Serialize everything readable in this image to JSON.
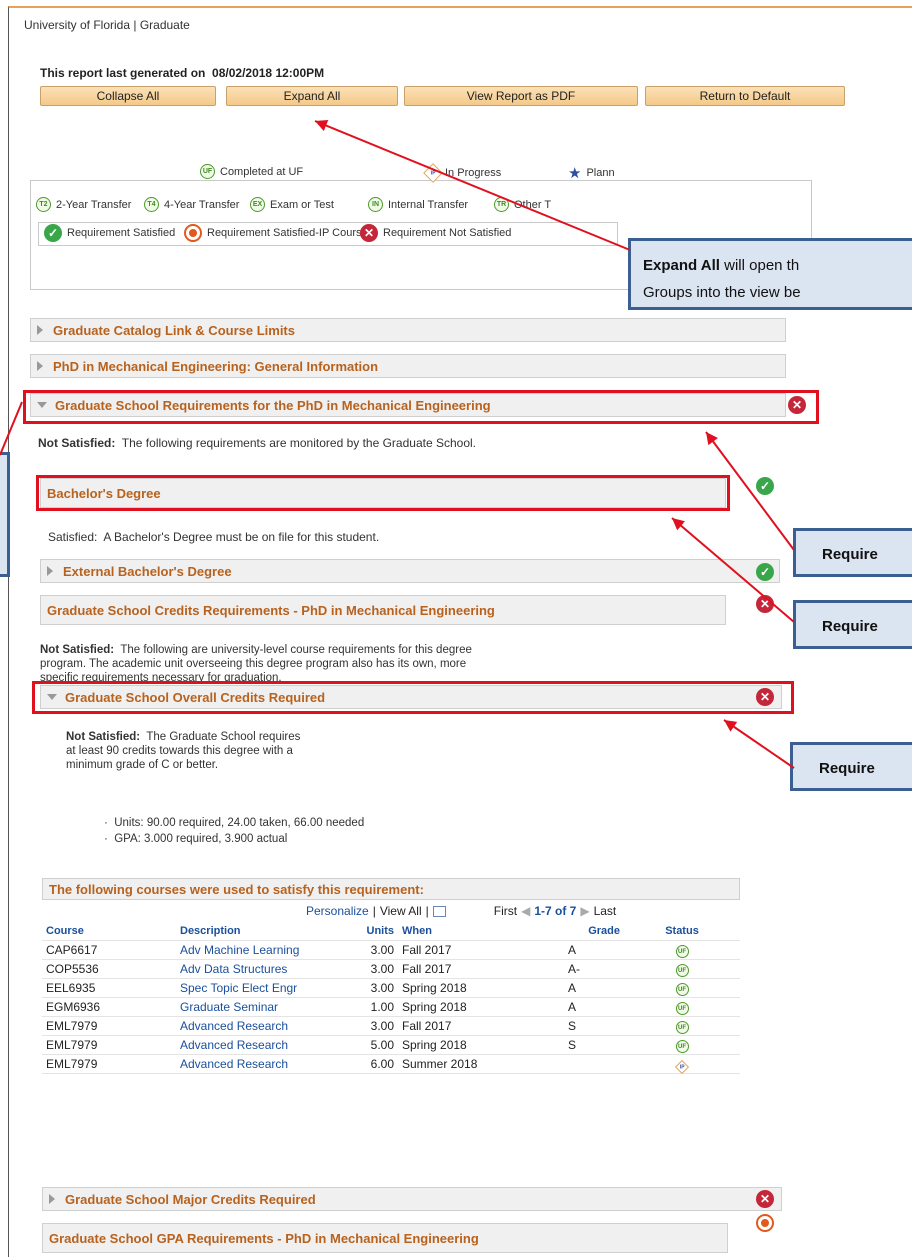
{
  "header": {
    "org": "University of Florida | Graduate",
    "generated_label": "This report last generated on",
    "generated_date": "08/02/2018 12:00PM"
  },
  "buttons": {
    "collapse": "Collapse All",
    "expand": "Expand All",
    "pdf": "View Report as PDF",
    "default": "Return to Default"
  },
  "legend": {
    "completed": "Completed at UF",
    "in_progress": "In Progress",
    "planned": "Plann",
    "t2": "2-Year Transfer",
    "t4": "4-Year Transfer",
    "exam": "Exam or Test",
    "internal": "Internal Transfer",
    "other": "Other T",
    "satisfied": "Requirement Satisfied",
    "satisfied_ip": "Requirement Satisfied-IP Course",
    "not_satisfied": "Requirement Not Satisfied",
    "icons": {
      "uf": "UF",
      "ip": "IP",
      "t2": "T2",
      "t4": "T4",
      "ex": "EX",
      "in": "IN",
      "tr": "TR"
    }
  },
  "sections": {
    "catalog": "Graduate Catalog Link & Course Limits",
    "general": "PhD in Mechanical Engineering: General Information",
    "grad_req": "Graduate School Requirements for the PhD in Mechanical Engineering",
    "grad_req_status_label": "Not Satisfied:",
    "grad_req_status_text": "The following requirements are monitored by the Graduate School.",
    "bachelors": "Bachelor's Degree",
    "bachelors_status_label": "Satisfied:",
    "bachelors_status_text": "A Bachelor's Degree must be on file for this student.",
    "external": "External Bachelor's Degree",
    "credits": "Graduate School Credits Requirements - PhD in Mechanical Engineering",
    "credits_status_label": "Not Satisfied:",
    "credits_status_line1": "The following are university-level course requirements for this degree",
    "credits_status_line2": "program. The academic unit overseeing this degree program also has its own, more",
    "credits_status_line3": "specific requirements necessary for graduation.",
    "overall": "Graduate School Overall Credits Required",
    "overall_status_label": "Not Satisfied:",
    "overall_line1": "The Graduate School requires",
    "overall_line2": "at least 90 credits towards this degree with a",
    "overall_line3": "minimum grade of C or better.",
    "units": "Units: 90.00 required, 24.00 taken, 66.00 needed",
    "gpa": "GPA: 3.000 required, 3.900 actual",
    "major": "Graduate School Major Credits Required",
    "gpa_req": "Graduate School GPA Requirements - PhD in Mechanical Engineering"
  },
  "courses": {
    "title": "The following courses were used to satisfy this requirement:",
    "personalize": "Personalize",
    "view_all": "View All",
    "first": "First",
    "range": "1-7 of 7",
    "last": "Last",
    "headers": [
      "Course",
      "Description",
      "Units",
      "When",
      "Grade",
      "Status"
    ],
    "rows": [
      {
        "course": "CAP6617",
        "desc": "Adv Machine Learning",
        "units": "3.00",
        "when": "Fall 2017",
        "grade": "A",
        "status": "UF"
      },
      {
        "course": "COP5536",
        "desc": "Adv Data Structures",
        "units": "3.00",
        "when": "Fall 2017",
        "grade": "A-",
        "status": "UF"
      },
      {
        "course": "EEL6935",
        "desc": "Spec Topic Elect Engr",
        "units": "3.00",
        "when": "Spring 2018",
        "grade": "A",
        "status": "UF"
      },
      {
        "course": "EGM6936",
        "desc": "Graduate Seminar",
        "units": "1.00",
        "when": "Spring 2018",
        "grade": "A",
        "status": "UF"
      },
      {
        "course": "EML7979",
        "desc": "Advanced Research",
        "units": "3.00",
        "when": "Fall 2017",
        "grade": "S",
        "status": "UF"
      },
      {
        "course": "EML7979",
        "desc": "Advanced Research",
        "units": "5.00",
        "when": "Spring 2018",
        "grade": "S",
        "status": "UF"
      },
      {
        "course": "EML7979",
        "desc": "Advanced Research",
        "units": "6.00",
        "when": "Summer 2018",
        "grade": "",
        "status": "IP"
      }
    ]
  },
  "callouts": {
    "expand_bold": "Expand All",
    "expand_line1": "will open th",
    "expand_line2": "Groups into the view be",
    "req1": "Require",
    "req2": "Require",
    "req3": "Require"
  },
  "colors": {
    "section_text": "#b8621e",
    "annotation": "#e0101e",
    "callout_bg": "#dbe4f1",
    "callout_border": "#3a5f90"
  }
}
